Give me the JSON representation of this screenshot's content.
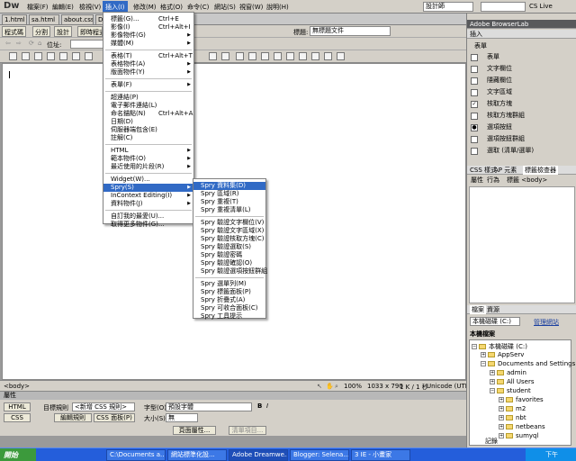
{
  "menubar": {
    "logo": "Dw",
    "items": [
      "檔案(F)",
      "編輯(E)",
      "檢視(V)",
      "插入(I)",
      "修改(M)",
      "格式(O)",
      "命令(C)",
      "網站(S)",
      "視窗(W)",
      "說明(H)"
    ],
    "workspace": "設計師",
    "cslive": "CS Live"
  },
  "doc_tabs": [
    "1.html",
    "sa.html",
    "about.css",
    "Dat"
  ],
  "toolbar": {
    "code": "程式碼",
    "split": "分割",
    "design": "設計",
    "live": "即時程式碼",
    "title_label": "標題:",
    "title_value": "無標題文件",
    "address_label": "位址:"
  },
  "insert_menu": {
    "items": [
      {
        "label": "標籤(G)...",
        "shortcut": "Ctrl+E",
        "submenu": false
      },
      {
        "label": "影像(I)",
        "shortcut": "Ctrl+Alt+I",
        "submenu": false
      },
      {
        "label": "影像物件(G)",
        "shortcut": "",
        "submenu": true
      },
      {
        "label": "媒體(M)",
        "shortcut": "",
        "submenu": true
      },
      {
        "sep": true
      },
      {
        "label": "表格(T)",
        "shortcut": "Ctrl+Alt+T",
        "submenu": false
      },
      {
        "label": "表格物件(A)",
        "shortcut": "",
        "submenu": true
      },
      {
        "label": "版面物件(Y)",
        "shortcut": "",
        "submenu": true
      },
      {
        "sep": true
      },
      {
        "label": "表單(F)",
        "shortcut": "",
        "submenu": true
      },
      {
        "sep": true
      },
      {
        "label": "超連結(P)",
        "shortcut": "",
        "submenu": false
      },
      {
        "label": "電子郵件連結(L)",
        "shortcut": "",
        "submenu": false
      },
      {
        "label": "命名錨點(N)",
        "shortcut": "Ctrl+Alt+A",
        "submenu": false
      },
      {
        "label": "日期(D)",
        "shortcut": "",
        "submenu": false
      },
      {
        "label": "伺服器端包含(E)",
        "shortcut": "",
        "submenu": false
      },
      {
        "label": "註解(C)",
        "shortcut": "",
        "submenu": false
      },
      {
        "sep": true
      },
      {
        "label": "HTML",
        "shortcut": "",
        "submenu": true
      },
      {
        "label": "範本物件(O)",
        "shortcut": "",
        "submenu": true
      },
      {
        "label": "最近使用的片段(R)",
        "shortcut": "",
        "submenu": true
      },
      {
        "sep": true
      },
      {
        "label": "Widget(W)...",
        "shortcut": "",
        "submenu": false
      },
      {
        "label": "Spry(S)",
        "shortcut": "",
        "submenu": true,
        "active": true
      },
      {
        "label": "InContext Editing(I)",
        "shortcut": "",
        "submenu": true
      },
      {
        "label": "資料物件(J)",
        "shortcut": "",
        "submenu": true
      },
      {
        "sep": true
      },
      {
        "label": "自訂我的最愛(U)...",
        "shortcut": "",
        "submenu": false
      },
      {
        "label": "取得更多物件(G)...",
        "shortcut": "",
        "submenu": false
      }
    ]
  },
  "spry_menu": {
    "items": [
      {
        "label": "Spry 資料集(D)",
        "active": true
      },
      {
        "label": "Spry 區域(R)"
      },
      {
        "label": "Spry 重複(T)"
      },
      {
        "label": "Spry 重複清單(L)"
      },
      {
        "sep": true
      },
      {
        "label": "Spry 驗證文字欄位(V)"
      },
      {
        "label": "Spry 驗證文字區域(X)"
      },
      {
        "label": "Spry 驗證核取方塊(C)"
      },
      {
        "label": "Spry 驗證選取(S)"
      },
      {
        "label": "Spry 驗證密碼"
      },
      {
        "label": "Spry 驗證確認(O)"
      },
      {
        "label": "Spry 驗證選項按鈕群組"
      },
      {
        "sep": true
      },
      {
        "label": "Spry 選單列(M)"
      },
      {
        "label": "Spry 標籤面板(P)"
      },
      {
        "label": "Spry 折疊式(A)"
      },
      {
        "label": "Spry 可收合面板(C)"
      },
      {
        "label": "Spry 工具提示"
      }
    ]
  },
  "status": {
    "tag": "<body>",
    "zoom": "100%",
    "dims": "1033 x 790",
    "size": "1 K / 1 秒",
    "encoding": "Unicode (UTF-8)"
  },
  "properties": {
    "title": "屬性",
    "html": "HTML",
    "css": "CSS",
    "target_rule_label": "目標規則",
    "target_rule_value": "<新增 CSS 規則>",
    "edit_rule": "編輯規則",
    "css_panel": "CSS 面板(P)",
    "font_label": "字型(O)",
    "font_value": "預設字體",
    "size_label": "大小(S)",
    "size_value": "無",
    "page_props": "頁面屬性...",
    "list_item": "清單項目..."
  },
  "right_panel": {
    "browserlab": "Adobe BrowserLab",
    "insert_title": "插入",
    "category": "表單",
    "insert_items": [
      "表單",
      "文字欄位",
      "隱藏欄位",
      "文字區域",
      "核取方塊",
      "核取方塊群組",
      "選項按鈕",
      "選項按鈕群組",
      "選取 (清單/選單)"
    ],
    "css_tabs": [
      "CSS 樣式",
      "AP 元素",
      "標籤檢查器"
    ],
    "attr_tabs": [
      "屬性",
      "行為",
      "標籤 <body>"
    ],
    "files_tabs": [
      "檔案",
      "資源"
    ],
    "drive": "本機磁碟 (C:)",
    "manage": "管理網站",
    "local_files": "本機檔案",
    "tree": [
      {
        "label": "本機磁碟 (C:)",
        "level": 0
      },
      {
        "label": "AppServ",
        "level": 1
      },
      {
        "label": "Documents and Settings",
        "level": 1
      },
      {
        "label": "admin",
        "level": 2
      },
      {
        "label": "All Users",
        "level": 2
      },
      {
        "label": "student",
        "level": 2
      },
      {
        "label": "favorites",
        "level": 3
      },
      {
        "label": "m2",
        "level": 3
      },
      {
        "label": "nbt",
        "level": 3
      },
      {
        "label": "netbeans",
        "level": 3
      },
      {
        "label": "sumyql",
        "level": 3
      }
    ],
    "log": "記錄"
  },
  "taskbar": {
    "start": "開始",
    "tasks": [
      "C:\\Documents a...",
      "網站標準化設...",
      "Adobe Dreamwe...",
      "Blogger: Selena...",
      "3 IE - 小畫家"
    ],
    "clock": "下午 09:46"
  }
}
